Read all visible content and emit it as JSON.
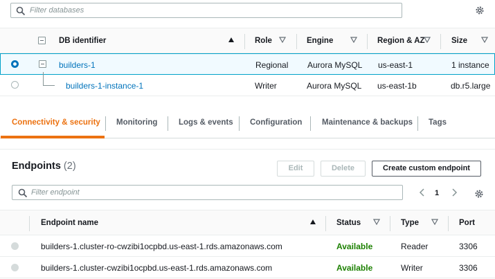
{
  "db_filter": {
    "placeholder": "Filter databases"
  },
  "db_table": {
    "headers": {
      "identifier": "DB identifier",
      "role": "Role",
      "engine": "Engine",
      "region": "Region & AZ",
      "size": "Size"
    },
    "rows": [
      {
        "identifier": "builders-1",
        "role": "Regional",
        "engine": "Aurora MySQL",
        "region": "us-east-1",
        "size": "1 instance",
        "selected": true
      },
      {
        "identifier": "builders-1-instance-1",
        "role": "Writer",
        "engine": "Aurora MySQL",
        "region": "us-east-1b",
        "size": "db.r5.large",
        "selected": false
      }
    ]
  },
  "tabs": [
    {
      "label": "Connectivity & security",
      "active": true
    },
    {
      "label": "Monitoring",
      "active": false
    },
    {
      "label": "Logs & events",
      "active": false
    },
    {
      "label": "Configuration",
      "active": false
    },
    {
      "label": "Maintenance & backups",
      "active": false
    },
    {
      "label": "Tags",
      "active": false
    }
  ],
  "endpoints": {
    "title": "Endpoints",
    "count": "(2)",
    "buttons": {
      "edit": "Edit",
      "delete": "Delete",
      "create": "Create custom endpoint"
    },
    "filter_placeholder": "Filter endpoint",
    "page": "1",
    "headers": {
      "name": "Endpoint name",
      "status": "Status",
      "type": "Type",
      "port": "Port"
    },
    "rows": [
      {
        "name": "builders-1.cluster-ro-cwzibi1ocpbd.us-east-1.rds.amazonaws.com",
        "status": "Available",
        "type": "Reader",
        "port": "3306"
      },
      {
        "name": "builders-1.cluster-cwzibi1ocpbd.us-east-1.rds.amazonaws.com",
        "status": "Available",
        "type": "Writer",
        "port": "3306"
      }
    ]
  },
  "colors": {
    "accent": "#ec7211",
    "link": "#0073bb",
    "available": "#1d8102",
    "selected_row_bg": "#f1faff"
  }
}
